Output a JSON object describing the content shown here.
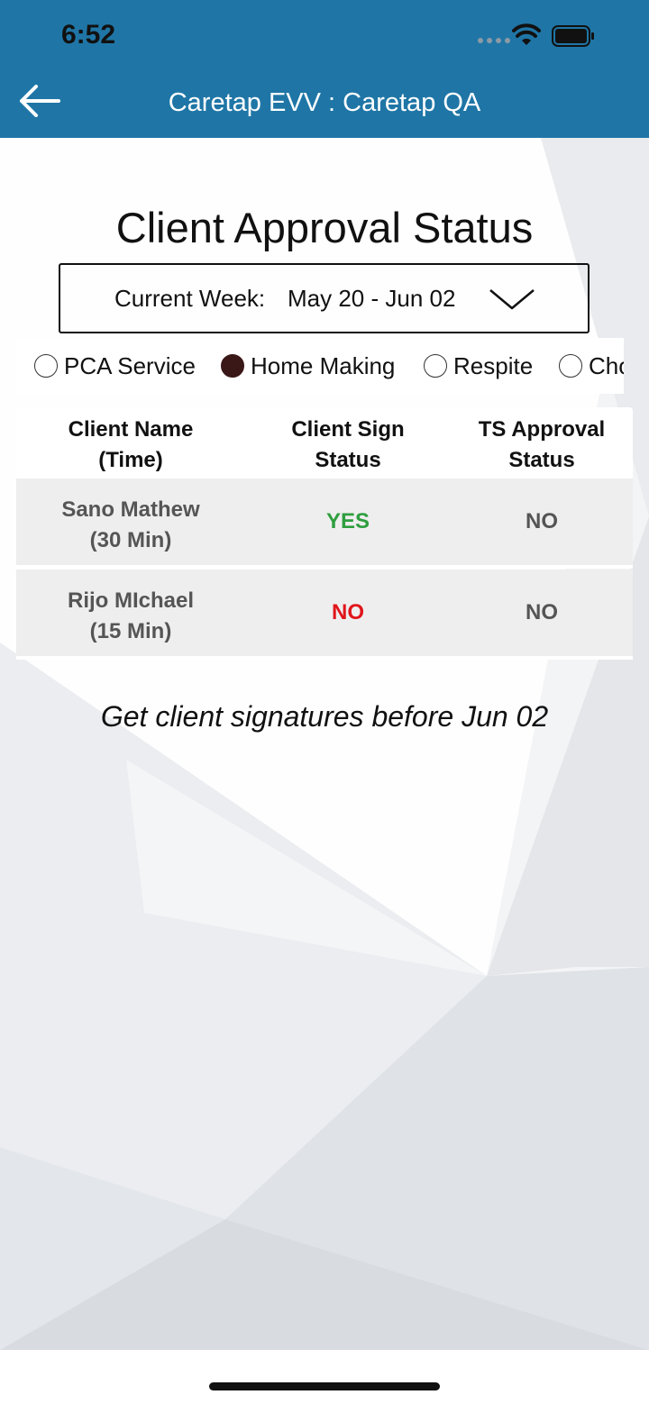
{
  "status_bar": {
    "time": "6:52",
    "icons": [
      "signal-dots-icon",
      "wifi-icon",
      "battery-icon"
    ]
  },
  "nav": {
    "title": "Caretap EVV : Caretap QA",
    "back_icon": "arrow-left-icon"
  },
  "page": {
    "title": "Client Approval Status"
  },
  "week_select": {
    "label": "Current Week:",
    "value": "May 20 - Jun 02",
    "icon": "chevron-down-icon"
  },
  "service_types": [
    {
      "label": "PCA Service",
      "selected": false
    },
    {
      "label": "Home Making",
      "selected": true
    },
    {
      "label": "Respite",
      "selected": false
    },
    {
      "label": "Cho",
      "selected": false
    }
  ],
  "table": {
    "headers": [
      {
        "line1": "Client Name",
        "line2": "(Time)"
      },
      {
        "line1": "Client Sign",
        "line2": "Status"
      },
      {
        "line1": "TS Approval",
        "line2": "Status"
      }
    ],
    "rows": [
      {
        "name": "Sano Mathew",
        "time": "(30 Min)",
        "sign_status": "YES",
        "ts_status": "NO"
      },
      {
        "name": "Rijo MIchael",
        "time": "(15 Min)",
        "sign_status": "NO",
        "ts_status": "NO"
      }
    ]
  },
  "note": "Get client signatures before Jun 02",
  "colors": {
    "header": "#1f76a6",
    "yes": "#2e9e3e",
    "no_sign": "#e0161b",
    "muted": "#555555"
  }
}
